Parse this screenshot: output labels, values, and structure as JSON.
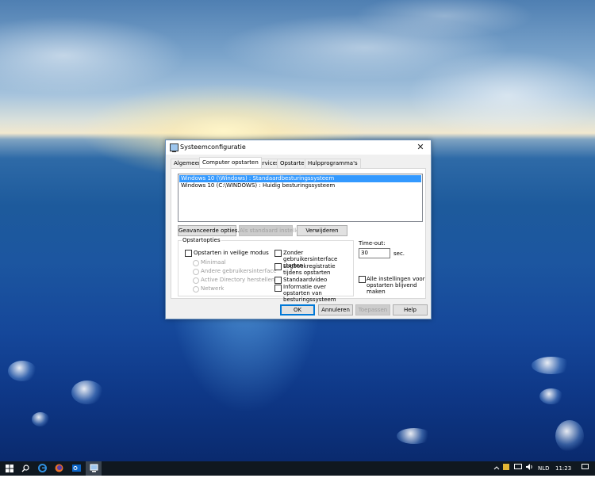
{
  "window": {
    "title": "Systeemconfiguratie",
    "close_glyph": "✕",
    "title_icon": "msconfig-icon"
  },
  "tabs": [
    {
      "label": "Algemeen",
      "active": false
    },
    {
      "label": "Computer opstarten",
      "active": true
    },
    {
      "label": "Services",
      "active": false
    },
    {
      "label": "Opstarten",
      "active": false
    },
    {
      "label": "Hulpprogramma's",
      "active": false
    }
  ],
  "boot": {
    "entries": [
      {
        "label": "Windows 10 (\\Windows) : Standaardbesturingssysteem",
        "selected": true
      },
      {
        "label": "Windows 10 (C:\\WINDOWS) : Huidig besturingssysteem",
        "selected": false
      }
    ],
    "buttons": {
      "advanced": "Geavanceerde opties...",
      "set_default": "Als standaard instellen",
      "delete": "Verwijderen"
    },
    "options": {
      "group_label": "Opstartopties",
      "safe_boot": {
        "label": "Opstarten in veilige modus",
        "checked": false
      },
      "safe_modes": [
        {
          "label": "Minimaal",
          "enabled": false
        },
        {
          "label": "Andere gebruikersinterface",
          "enabled": false
        },
        {
          "label": "Active Directory herstellen",
          "enabled": false
        },
        {
          "label": "Netwerk",
          "enabled": false
        }
      ],
      "right_checks": [
        {
          "label": "Zonder gebruikersinterface starten",
          "checked": false
        },
        {
          "label": "Logboekregistratie tijdens opstarten",
          "checked": false
        },
        {
          "label": "Standaardvideo",
          "checked": false
        },
        {
          "label": "Informatie over opstarten van besturingssysteem",
          "checked": false
        }
      ]
    },
    "timeout": {
      "label": "Time-out:",
      "value": "30",
      "unit": "sec."
    },
    "permanent": {
      "label": "Alle instellingen voor opstarten blijvend maken",
      "checked": false
    }
  },
  "dialog_buttons": {
    "ok": "OK",
    "cancel": "Annuleren",
    "apply": "Toepassen",
    "help": "Help"
  },
  "taskbar": {
    "icons": [
      "windows-start-icon",
      "search-icon",
      "edge-icon",
      "firefox-icon",
      "outlook-icon",
      "msconfig-icon"
    ],
    "language": "NLD",
    "time": "11:23"
  }
}
